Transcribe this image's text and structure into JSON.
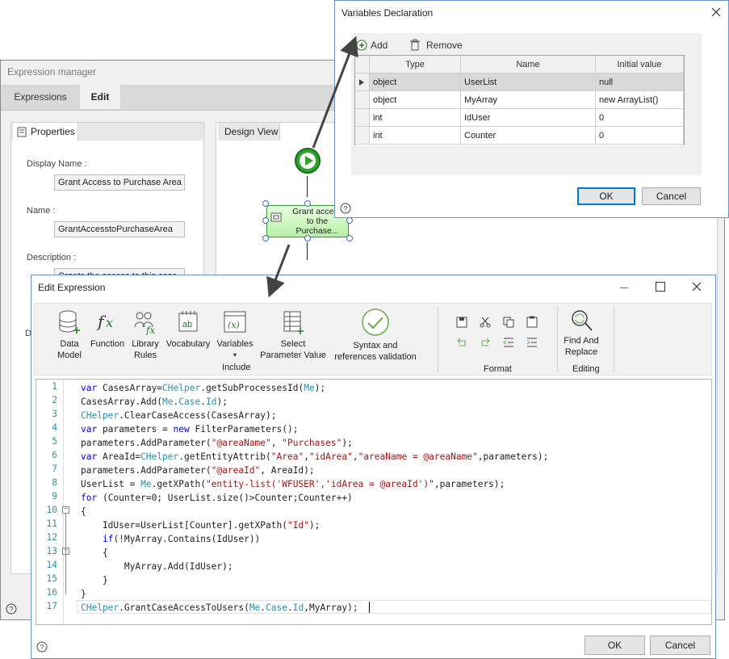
{
  "expression_manager": {
    "title": "Expression manager",
    "tabs": [
      "Expressions",
      "Edit"
    ],
    "active_tab": "Edit",
    "properties_tab": "Properties",
    "display_name_label": "Display Name :",
    "display_name_value": "Grant Access to Purchase Area",
    "name_label": "Name :",
    "name_value": "GrantAccesstoPurchaseArea",
    "description_label": "Description :",
    "description_value": "Grants the access to this case",
    "cut_label": "D",
    "design_view_tab": "Design View",
    "task_label": "Grant access to the Purchase..."
  },
  "variables_dialog": {
    "title": "Variables Declaration",
    "add_label": "Add",
    "remove_label": "Remove",
    "columns": [
      "Type",
      "Name",
      "Initial value"
    ],
    "rows": [
      {
        "type": "object",
        "name": "UserList",
        "initial": "null"
      },
      {
        "type": "object",
        "name": "MyArray",
        "initial": "new ArrayList()"
      },
      {
        "type": "int",
        "name": "IdUser",
        "initial": "0"
      },
      {
        "type": "int",
        "name": "Counter",
        "initial": "0"
      }
    ],
    "ok_label": "OK",
    "cancel_label": "Cancel"
  },
  "edit_expression": {
    "title": "Edit Expression",
    "toolbar": {
      "data_model": "Data Model",
      "function": "Function",
      "library_rules": "Library Rules",
      "vocabulary": "Vocabulary",
      "variables": "Variables",
      "select_parameter": "Select Parameter Value",
      "syntax_validation": "Syntax and references validation",
      "include_group": "Include",
      "format_group": "Format",
      "find_replace": "Find And Replace",
      "editing_group": "Editing"
    },
    "code_lines": [
      "var CasesArray=CHelper.getSubProcessesId(Me);",
      "CasesArray.Add(Me.Case.Id);",
      "CHelper.ClearCaseAccess(CasesArray);",
      "var parameters = new FilterParameters();",
      "parameters.AddParameter(\"@areaName\", \"Purchases\");",
      "var AreaId=CHelper.getEntityAttrib(\"Area\",\"idArea\",\"areaName = @areaName\",parameters);",
      "parameters.AddParameter(\"@areaId\", AreaId);",
      "UserList = Me.getXPath(\"entity-list('WFUSER','idArea = @areaId')\",parameters);",
      "for (Counter=0; UserList.size()>Counter;Counter++)",
      "{",
      "    IdUser=UserList[Counter].getXPath(\"Id\");",
      "    if(!MyArray.Contains(IdUser))",
      "    {",
      "        MyArray.Add(IdUser);",
      "    }",
      "}",
      "CHelper.GrantCaseAccessToUsers(Me.Case.Id,MyArray);"
    ],
    "line_numbers": [
      "1",
      "2",
      "3",
      "4",
      "5",
      "6",
      "7",
      "8",
      "9",
      "10",
      "11",
      "12",
      "13",
      "14",
      "15",
      "16",
      "17"
    ],
    "ok_label": "OK",
    "cancel_label": "Cancel"
  },
  "colors": {
    "keyword": "#0000ff",
    "helper": "#2b91af",
    "string": "#a31515",
    "accent": "#0078d7"
  }
}
